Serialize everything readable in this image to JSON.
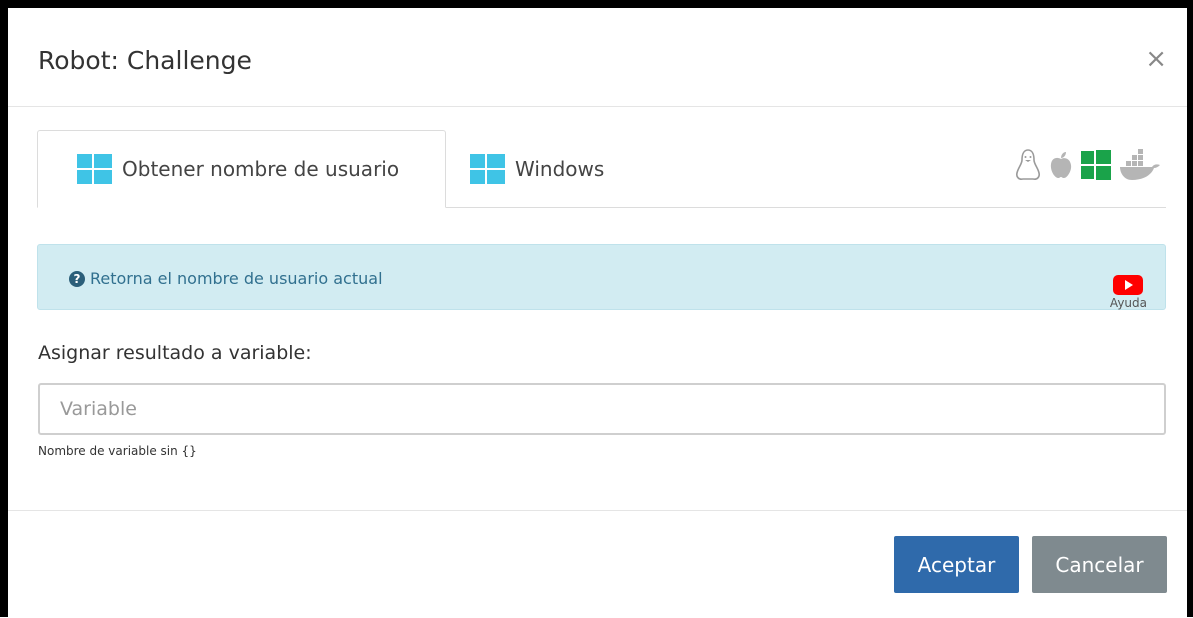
{
  "modal": {
    "title": "Robot: Challenge",
    "close_symbol": "×"
  },
  "tabs": [
    {
      "label": "Obtener nombre de usuario",
      "icon": "windows-icon",
      "active": true
    },
    {
      "label": "Windows",
      "icon": "windows-icon",
      "active": false
    }
  ],
  "os_icons": [
    "linux-icon",
    "apple-icon",
    "windows-icon",
    "docker-icon"
  ],
  "alert": {
    "text": "Retorna el nombre de usuario actual",
    "help_label": "Ayuda"
  },
  "form": {
    "label": "Asignar resultado a variable:",
    "placeholder": "Variable",
    "value": "",
    "hint": "Nombre de variable sin {}"
  },
  "footer": {
    "accept_label": "Aceptar",
    "cancel_label": "Cancelar"
  },
  "colors": {
    "windows_tab_icon": "#3fc4e6",
    "windows_os_icon": "#1aa34a",
    "alert_bg": "#d2ecf2",
    "accept_button": "#2f6aab",
    "cancel_button": "#7f8a8f",
    "youtube_red": "#ff0000"
  }
}
